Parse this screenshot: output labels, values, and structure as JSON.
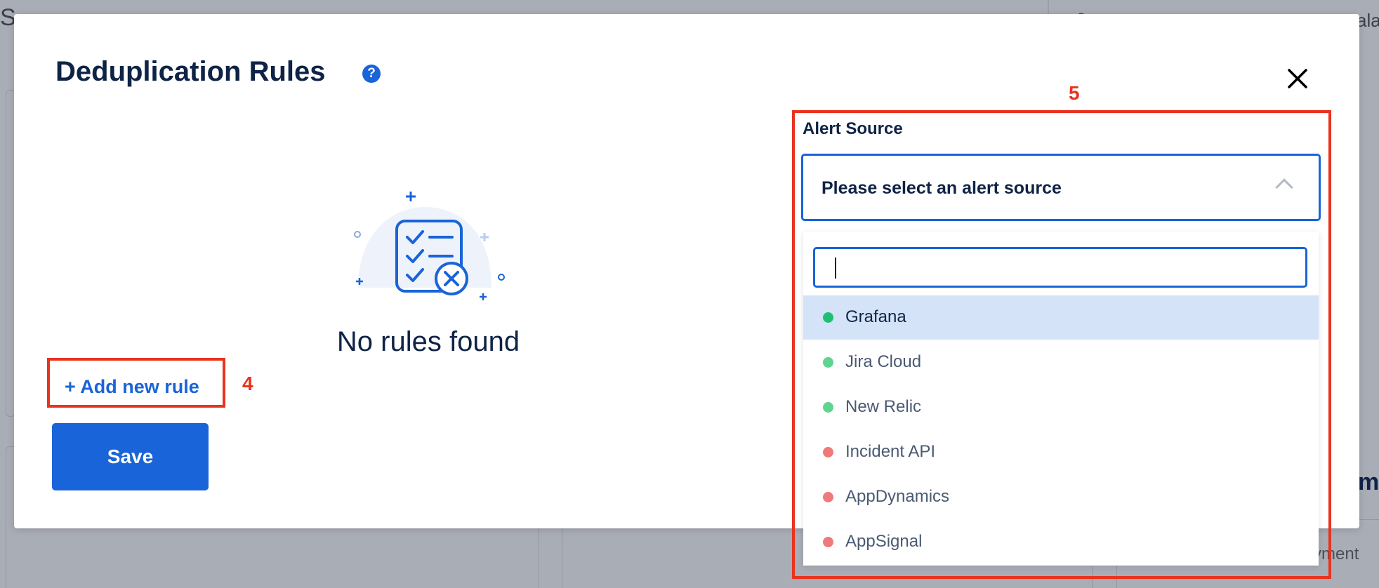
{
  "background": {
    "top_left_text": "S",
    "top_right_text": "ala",
    "right_mid_text": "m",
    "right_bottom_text": "yment"
  },
  "modal": {
    "title": "Deduplication Rules",
    "help_icon_glyph": "?",
    "close_icon_glyph": "×",
    "empty_state_text": "No rules found",
    "add_rule_label": "+ Add new rule",
    "save_label": "Save"
  },
  "annotations": {
    "add_rule_number": "4",
    "alert_source_number": "5",
    "color": "#e8331f"
  },
  "alert_source": {
    "label": "Alert Source",
    "placeholder": "Please select an alert source",
    "search_value": "",
    "options": [
      {
        "label": "Grafana",
        "status_color": "#1dbf73",
        "highlighted": true
      },
      {
        "label": "Jira Cloud",
        "status_color": "#5fd390",
        "highlighted": false
      },
      {
        "label": "New Relic",
        "status_color": "#5fd390",
        "highlighted": false
      },
      {
        "label": "Incident API",
        "status_color": "#f07a7a",
        "highlighted": false
      },
      {
        "label": "AppDynamics",
        "status_color": "#f07a7a",
        "highlighted": false
      },
      {
        "label": "AppSignal",
        "status_color": "#f07a7a",
        "highlighted": false
      }
    ]
  },
  "colors": {
    "primary": "#1964d8",
    "text_dark": "#0f2346",
    "highlight": "#d4e3f8"
  }
}
